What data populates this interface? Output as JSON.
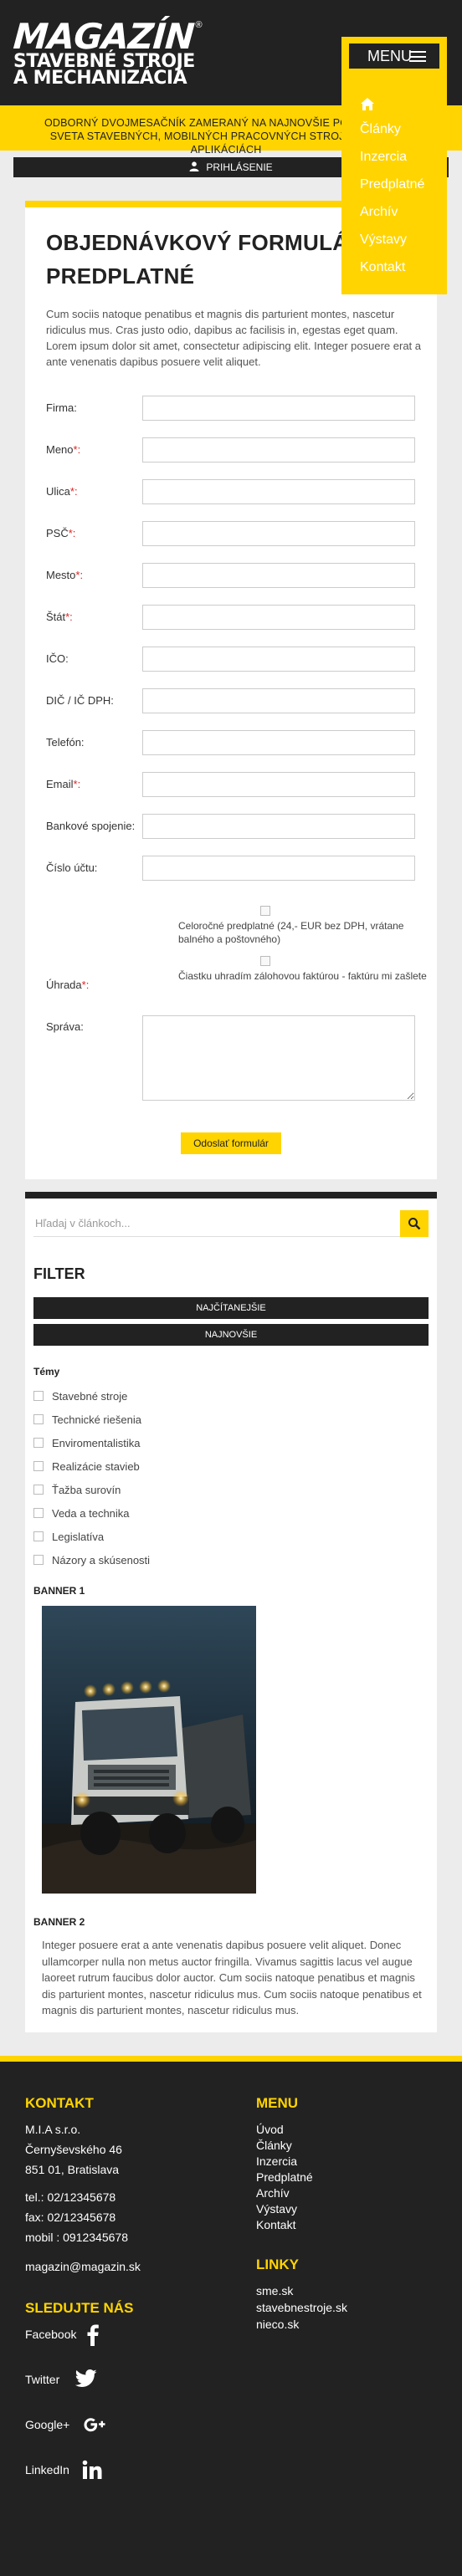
{
  "header": {
    "logo_brand": "MAGAZÍN",
    "logo_reg": "®",
    "logo_tag_line1": "STAVEBNÉ STROJE",
    "logo_tag_line2": "A MECHANIZÁCIA",
    "menu_label": "MENU"
  },
  "menu": {
    "items": [
      "Články",
      "Inzercia",
      "Predplatné",
      "Archív",
      "Výstavy",
      "Kontakt"
    ]
  },
  "notice": {
    "text": "ODBORNÝ DVOJMESAČNÍK ZAMERANÝ NA NAJNOVŠIE POZNATKY ZO SVETA STAVEBNÝCH, MOBILNÝCH PRACOVNÝCH STROJOV A O ICH APLIKÁCIÁCH"
  },
  "login": {
    "label": "PRIHLÁSENIE"
  },
  "form": {
    "title_line1": "OBJEDNÁVKOVÝ FORMULÁR",
    "title_line2": "PREDPLATNÉ",
    "intro": "Cum sociis natoque penatibus et magnis dis parturient montes, nascetur ridiculus mus. Cras justo odio, dapibus ac facilisis in, egestas eget quam. Lorem ipsum dolor sit amet, consectetur adipiscing elit. Integer posuere erat a ante venenatis dapibus posuere velit aliquet.",
    "fields": [
      {
        "label": "Firma:",
        "req": ""
      },
      {
        "label": "Meno",
        "req": "*:"
      },
      {
        "label": "Ulica",
        "req": "*:"
      },
      {
        "label": "PSČ",
        "req": "*:"
      },
      {
        "label": "Mesto",
        "req": "*:"
      },
      {
        "label": "Štát",
        "req": "*:"
      },
      {
        "label": "IČO:",
        "req": ""
      },
      {
        "label": "DIČ / IČ DPH:",
        "req": ""
      },
      {
        "label": "Telefón:",
        "req": ""
      },
      {
        "label": "Email",
        "req": "*:"
      },
      {
        "label": "Bankové spojenie:",
        "req": ""
      },
      {
        "label": "Číslo účtu:",
        "req": ""
      }
    ],
    "uhrada_label": "Úhrada",
    "uhrada_req": "*:",
    "option1": "Celoročné predplatné (24,- EUR bez DPH, vrátane balného a poštovného)",
    "option2": "Čiastku uhradím zálohovou faktúrou - faktúru mi zašlete",
    "sprava_label": "Správa:",
    "submit_label": "Odoslať formulár"
  },
  "sidebar": {
    "search_placeholder": "Hľadaj v článkoch...",
    "filter_heading": "FILTER",
    "btn_most_read": "NAJČÍTANEJŠIE",
    "btn_newest": "NAJNOVŠIE",
    "topics_heading": "Témy",
    "topics": [
      "Stavebné stroje",
      "Technické riešenia",
      "Enviromentalistika",
      "Realizácie stavieb",
      "Ťažba surovín",
      "Veda a technika",
      "Legislatíva",
      "Názory a skúsenosti"
    ],
    "banner1_heading": "BANNER 1",
    "banner2_heading": "BANNER 2",
    "banner2_text": "Integer posuere erat a ante venenatis dapibus posuere velit aliquet. Donec ullamcorper nulla non metus auctor fringilla. Vivamus sagittis lacus vel augue laoreet rutrum faucibus dolor auctor. Cum sociis natoque penatibus et magnis dis parturient montes, nascetur ridiculus mus. Cum sociis natoque penatibus et magnis dis parturient montes, nascetur ridiculus mus."
  },
  "footer": {
    "contact_heading": "KONTAKT",
    "company": "M.I.A s.r.o.",
    "street": "Černyševského 46",
    "city": "851 01, Bratislava",
    "tel": "tel.: 02/12345678",
    "fax": "fax: 02/12345678",
    "mobil": "mobil : 0912345678",
    "email": "magazin@magazin.sk",
    "follow_heading": "SLEDUJTE NÁS",
    "social": [
      "Facebook",
      "Twitter",
      "Google+",
      "LinkedIn"
    ],
    "menu_heading": "MENU",
    "menu_items": [
      "Úvod",
      "Články",
      "Inzercia",
      "Predplatné",
      "Archív",
      "Výstavy",
      "Kontakt"
    ],
    "links_heading": "LINKY",
    "links": [
      "sme.sk",
      "stavebnestroje.sk",
      "nieco.sk"
    ]
  },
  "colors": {
    "accent": "#ffd400",
    "dark": "#222222",
    "required": "#dd2222"
  }
}
